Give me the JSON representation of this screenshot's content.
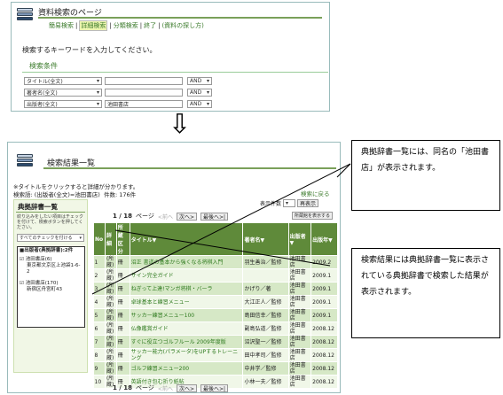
{
  "top": {
    "title": "資料検索のページ",
    "nav": [
      "簡易検索",
      "詳細検索",
      "分類検索",
      "終了",
      "(資料の探し方)"
    ],
    "prompt": "検索するキーワードを入力してください。",
    "conditions_label": "検索条件",
    "rows": [
      {
        "field": "タイトル(全文)",
        "value": "",
        "op": "AND"
      },
      {
        "field": "著者名(全文)",
        "value": "",
        "op": "AND"
      },
      {
        "field": "出版者(全文)",
        "value": "池田書店",
        "op": "AND"
      }
    ]
  },
  "arrow": "⇩",
  "bottom": {
    "title": "検索結果一覧",
    "hint": "※タイトルをクリックすると詳細が分かります。",
    "query": "検索語: (出版者(全文)=池田書店)",
    "count": "件数: 176件",
    "back_link": "検索に戻る",
    "display_count_label": "表示件数",
    "redisplay": "再表示",
    "pager": {
      "page": "1 / 18",
      "label": "ページ",
      "prev": "<前へ",
      "next": "次へ>",
      "last": "最後へ>|"
    },
    "show_all": "所蔵館を表示する",
    "sidebar": {
      "heading": "典拠辞書一覧",
      "desc": "絞り込みをしたい項目はチェックを付けて、検索ボタンを押してください。",
      "check_all": "すべてのチェックを付ける",
      "group": "■出版者(典拠辞書):2件",
      "items": [
        {
          "name": "池田書店(6)",
          "addr": "東京都文京区上池袋1-6-2"
        },
        {
          "name": "池田書店(170)",
          "addr": "新宿区舟宮町43"
        }
      ]
    },
    "columns": [
      "No",
      "詳細",
      "所蔵区分",
      "タイトル▼",
      "著者名▼",
      "出版者▼",
      "出版年▼"
    ],
    "results": [
      {
        "no": "1",
        "s": "(所蔵)",
        "k": "冊",
        "title": "沼正 書道の基本から強くなる将棋入門",
        "author": "羽生善治／監修",
        "pub": "池田書店",
        "year": "2009.2"
      },
      {
        "no": "2",
        "s": "(所蔵)",
        "k": "冊",
        "title": "サイン完全ガイド",
        "author": "",
        "pub": "池田書店",
        "year": "2009.1"
      },
      {
        "no": "3",
        "s": "(所蔵)",
        "k": "冊",
        "title": "ねぎって上達!マンガ将棋・バーラ",
        "author": "かげり／著",
        "pub": "池田書店",
        "year": "2009.1"
      },
      {
        "no": "4",
        "s": "(所蔵)",
        "k": "冊",
        "title": "卓球基本と練習メニュー",
        "author": "大江正人／監修",
        "pub": "池田書店",
        "year": "2009.1"
      },
      {
        "no": "5",
        "s": "(所蔵)",
        "k": "冊",
        "title": "サッカー練習メニュー100",
        "author": "島田信幸／監修",
        "pub": "池田書店",
        "year": "2009.1"
      },
      {
        "no": "6",
        "s": "(所蔵)",
        "k": "冊",
        "title": "仏像鑑賞ガイド",
        "author": "副島弘道／監修",
        "pub": "池田書店",
        "year": "2008.12"
      },
      {
        "no": "7",
        "s": "(所蔵)",
        "k": "冊",
        "title": "すぐに役立つゴルフルール 2009年度版",
        "author": "沼沢聖一／監修",
        "pub": "池田書店",
        "year": "2008.12"
      },
      {
        "no": "8",
        "s": "(所蔵)",
        "k": "冊",
        "title": "サッカー能力(パラメータ)をUPするトレーニング",
        "author": "田中孝司／監修",
        "pub": "池田書店",
        "year": "2008.12"
      },
      {
        "no": "9",
        "s": "(所蔵)",
        "k": "冊",
        "title": "ゴルフ練習メニュー200",
        "author": "中井学／監修",
        "pub": "池田書店",
        "year": "2008.12"
      },
      {
        "no": "10",
        "s": "(所蔵)",
        "k": "冊",
        "title": "英語付き包む折り紙帖",
        "author": "小林一夫／監修",
        "pub": "池田書店",
        "year": "2008.12"
      }
    ]
  },
  "callouts": [
    "典拠辞書一覧には、同名の「池田書店」が表示されます。",
    "検索結果には典拠辞書一覧に表示されている典拠辞書で検索した結果が表示されます。"
  ]
}
